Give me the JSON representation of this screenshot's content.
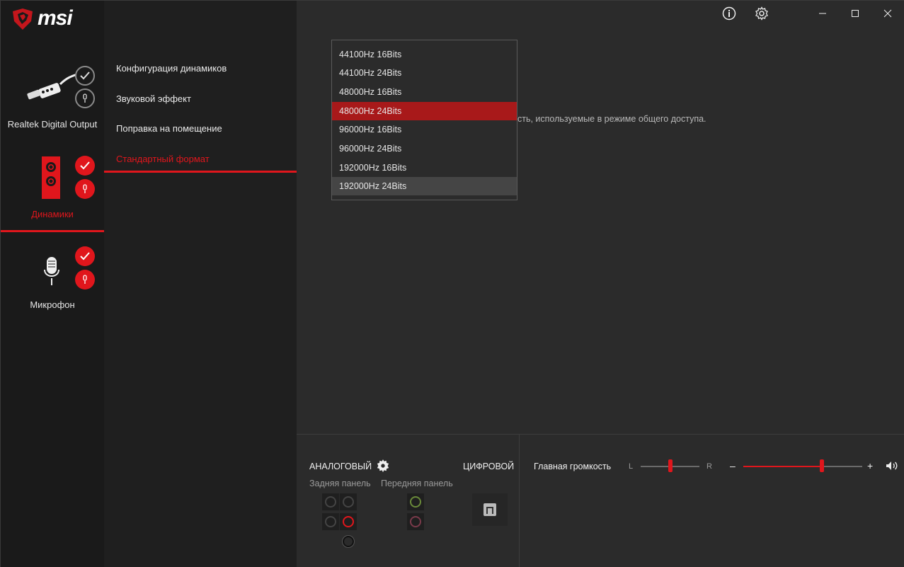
{
  "app": {
    "brand": "msi",
    "colors": {
      "accent": "#e0161c",
      "bg": "#2b2b2b",
      "sidebar": "#1a1a1a"
    }
  },
  "devices": [
    {
      "label": "Realtek Digital Output",
      "icon": "optical-cable-icon",
      "active": false
    },
    {
      "label": "Динамики",
      "icon": "speaker-icon",
      "active": true
    },
    {
      "label": "Микрофон",
      "icon": "microphone-icon",
      "active": false
    }
  ],
  "menu": {
    "items": [
      {
        "label": "Конфигурация динамиков"
      },
      {
        "label": "Звуковой эффект"
      },
      {
        "label": "Поправка на помещение"
      },
      {
        "label": "Стандартный формат",
        "active": true
      }
    ]
  },
  "titlebar": {
    "icons": [
      "info-icon",
      "settings-gear-icon",
      "minimize-icon",
      "maximize-icon",
      "close-icon"
    ]
  },
  "main": {
    "description_partial": "сть, используемые в режиме общего доступа."
  },
  "format_dropdown": {
    "options": [
      "44100Hz 16Bits",
      "44100Hz 24Bits",
      "48000Hz 16Bits",
      "48000Hz 24Bits",
      "96000Hz 16Bits",
      "96000Hz 24Bits",
      "192000Hz 16Bits",
      "192000Hz 24Bits"
    ],
    "selected": "48000Hz 24Bits",
    "hovered": "192000Hz 24Bits"
  },
  "bottom": {
    "analog_label": "АНАЛОГОВЫЙ",
    "digital_label": "ЦИФРОВОЙ",
    "rear_panel_label": "Задняя панель",
    "front_panel_label": "Передняя панель",
    "master_volume_label": "Главная громкость",
    "balance_left": "L",
    "balance_right": "R",
    "volume_minus": "–",
    "volume_plus": "+",
    "balance_value": 0.5,
    "volume_value": 0.66
  }
}
